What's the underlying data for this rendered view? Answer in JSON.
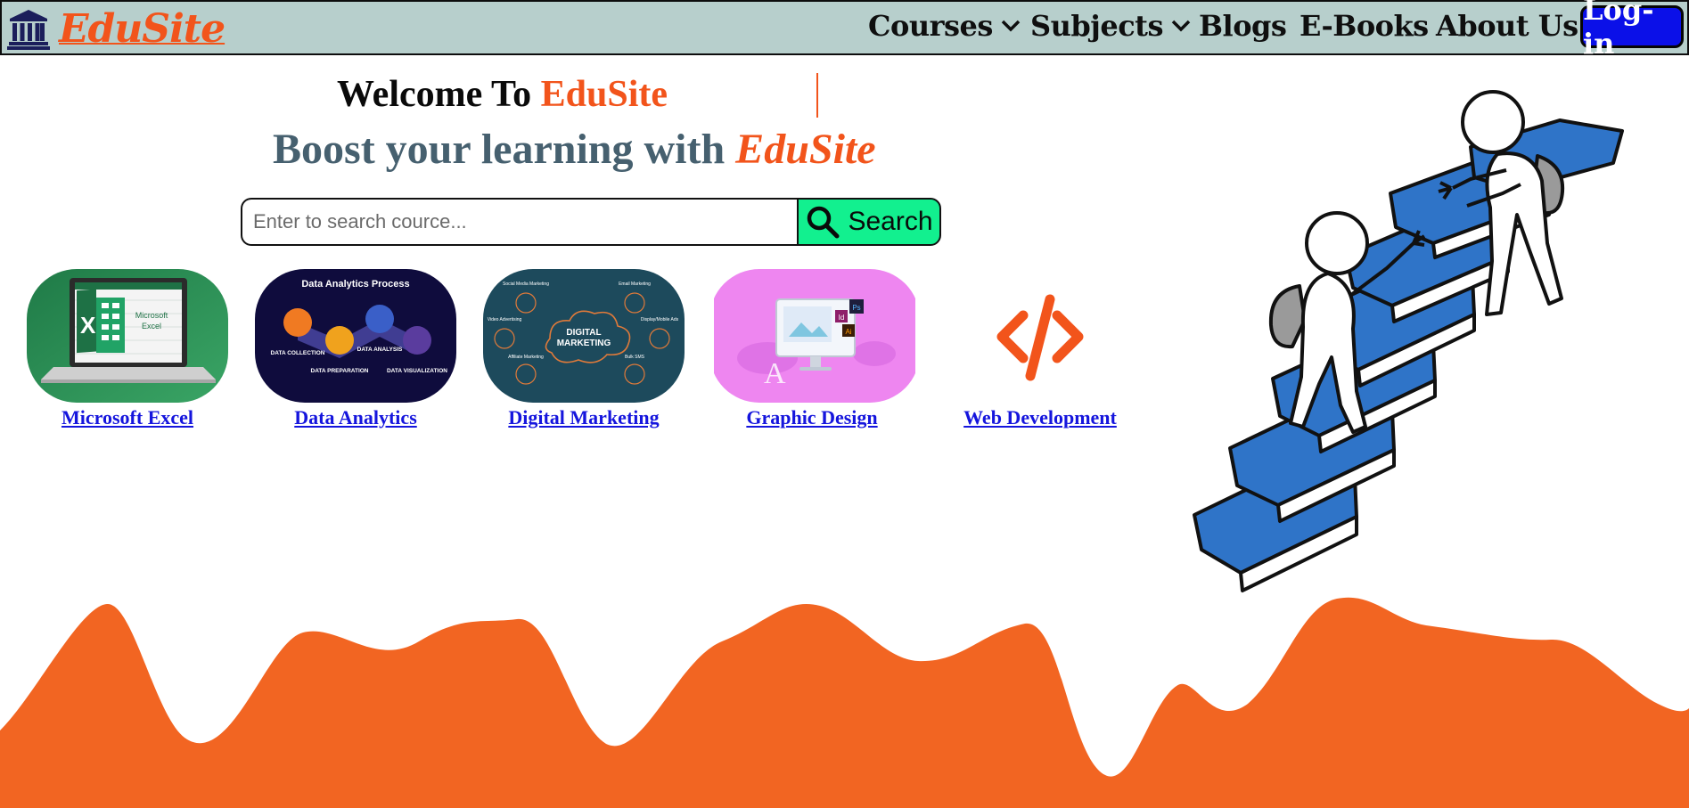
{
  "nav": {
    "brand": "EduSite",
    "links": [
      {
        "label": "Courses",
        "dropdown": true
      },
      {
        "label": "Subjects",
        "dropdown": true
      },
      {
        "label": "Blogs",
        "dropdown": false
      },
      {
        "label": "E-Books",
        "dropdown": false
      },
      {
        "label": "About Us",
        "dropdown": false
      }
    ],
    "login_label": "Log-in"
  },
  "hero": {
    "welcome_prefix": "Welcome To ",
    "welcome_brand": "EduSite",
    "boost_prefix": "Boost your learning with ",
    "boost_brand": "EduSite"
  },
  "search": {
    "placeholder": "Enter to search cource...",
    "value": "",
    "button_label": "Search"
  },
  "courses": [
    {
      "label": "Microsoft Excel",
      "image_text": [
        "Microsoft",
        "Excel"
      ]
    },
    {
      "label": "Data Analytics",
      "image_text": [
        "Data Analytics Process",
        "DATA COLLECTION",
        "DATA PREPARATION",
        "DATA ANALYSIS",
        "DATA VISUALIZATION"
      ]
    },
    {
      "label": "Digital Marketing",
      "image_text": [
        "DIGITAL",
        "MARKETING",
        "Social Media Marketing",
        "Email Marketing",
        "Video Advertising",
        "Display/Mobile Ads",
        "Affiliate Marketing",
        "Bulk SMS"
      ]
    },
    {
      "label": "Graphic Design",
      "image_text": [
        "Ps",
        "Id",
        "Ai"
      ]
    },
    {
      "label": "Web Development",
      "image_text": []
    }
  ],
  "colors": {
    "accent": "#f2541b",
    "navbar_bg": "#b7cfcc",
    "login_bg": "#0b10e8",
    "search_btn": "#12f08f",
    "link": "#1515dd",
    "wave": "#f26522"
  }
}
